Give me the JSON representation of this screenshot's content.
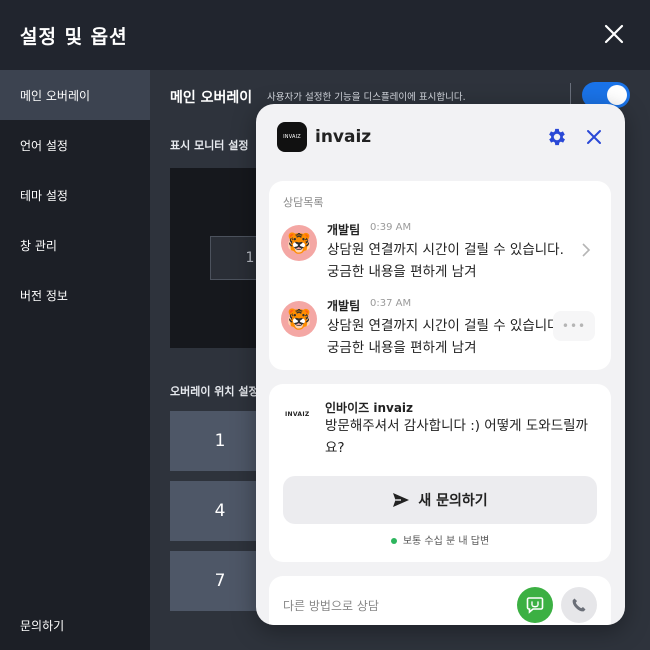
{
  "window": {
    "title": "설정 및 옵션"
  },
  "sidebar": {
    "items": [
      {
        "label": "메인 오버레이",
        "active": true
      },
      {
        "label": "언어 설정"
      },
      {
        "label": "테마 설정"
      },
      {
        "label": "창 관리"
      },
      {
        "label": "버전 정보"
      }
    ],
    "bottom": "문의하기"
  },
  "main": {
    "section_title": "메인 오버레이",
    "section_desc": "사용자가 설정한 기능을 디스플레이에 표시합니다.",
    "toggle_on": true,
    "monitor_label": "표시 모니터 설정",
    "monitor_number": "1",
    "position_label": "오버레이 위치 설정",
    "positions": [
      "1",
      "4",
      "7"
    ]
  },
  "widget": {
    "logo_text": "INVAIZ",
    "brand": "invaiz",
    "list_title": "상담목록",
    "conversations": [
      {
        "sender": "개발팀",
        "time": "0:39 AM",
        "message": "상담원 연결까지 시간이 걸릴 수 있습니다. 궁금한 내용을 편하게 남겨",
        "avatar": "🐯"
      },
      {
        "sender": "개발팀",
        "time": "0:37 AM",
        "message": "상담원 연결까지 시간이 걸릴 수 있습니다. 궁금한 내용을 편하게 남겨",
        "avatar": "🐯",
        "more": "•••"
      }
    ],
    "intro": {
      "logo_text": "INVAIZ",
      "name": "인바이즈 invaiz",
      "message": "방문해주셔서 감사합니다 :) 어떻게 도와드릴까요?",
      "button": "새 문의하기",
      "reply_note": "보통 수십 분 내 답변"
    },
    "other_label": "다른 방법으로 상담",
    "colors": {
      "accent": "#1a73e8",
      "icon_blue": "#2a48d6",
      "chat_green": "#3cb043",
      "status_green": "#2db55d"
    }
  }
}
